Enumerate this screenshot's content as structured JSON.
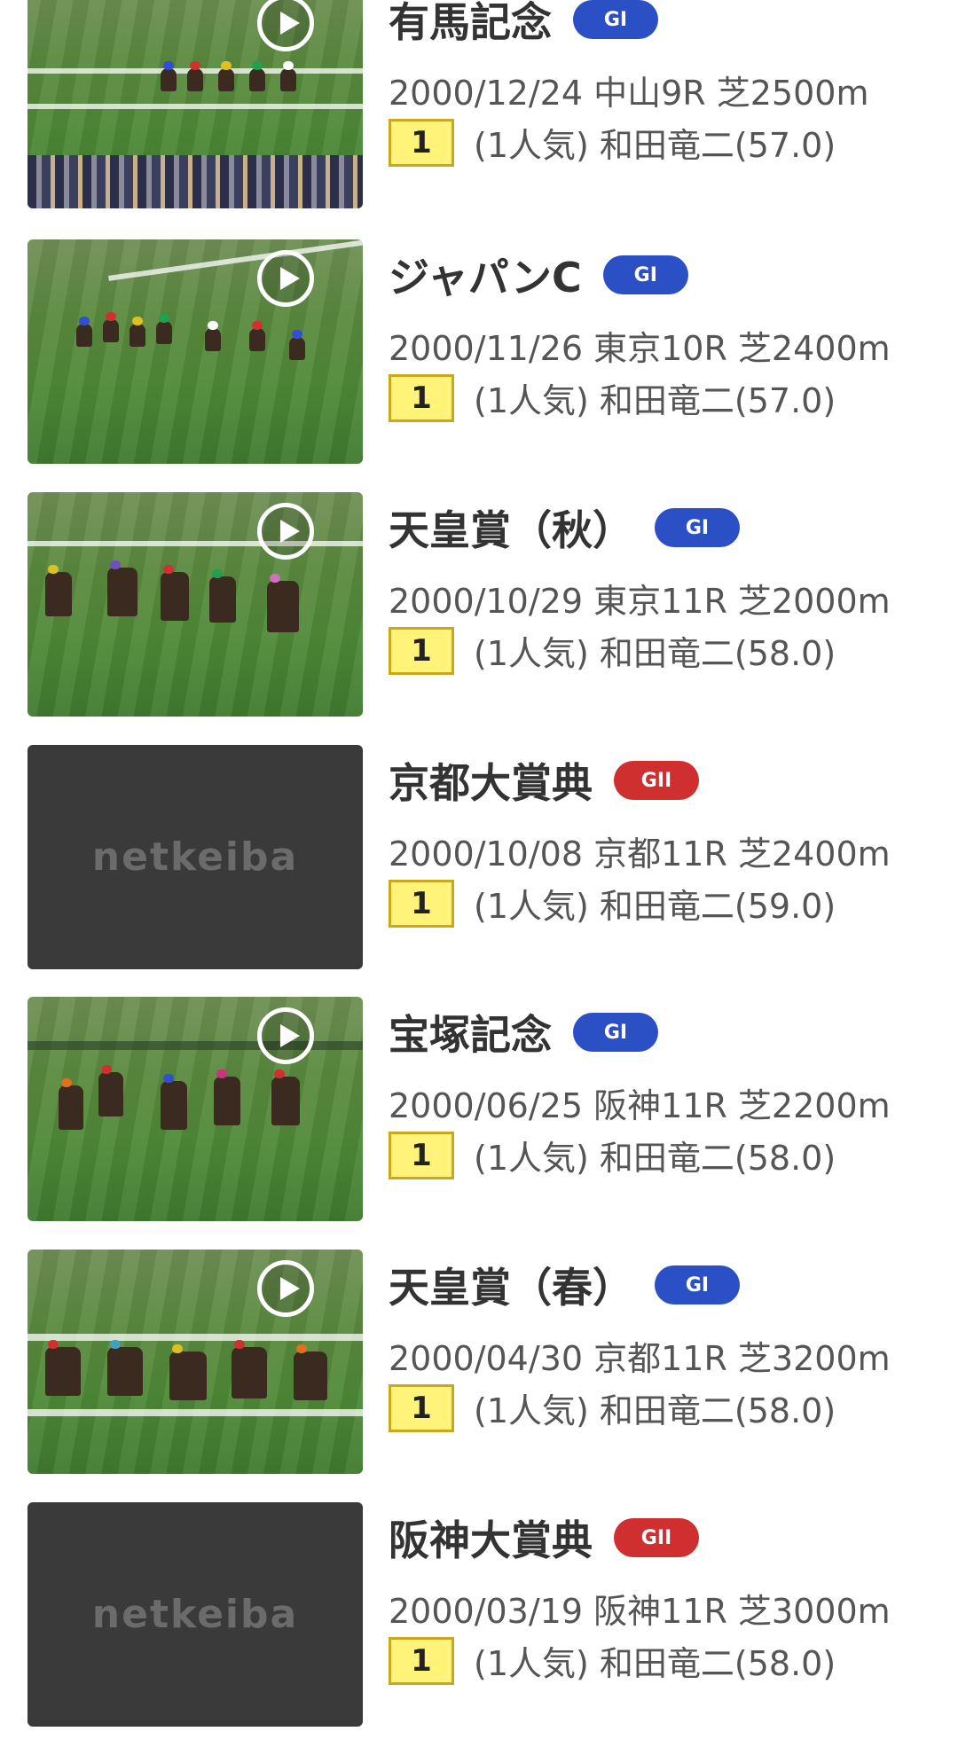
{
  "races": [
    {
      "title": "有馬記念",
      "grade": "GI",
      "grade_color": "#2b4fc4",
      "date_course": "2000/12/24 中山9R 芝2500m",
      "rank": "1",
      "detail": "(1人気) 和田竜二(57.0)",
      "has_video": true
    },
    {
      "title": "ジャパンC",
      "grade": "GI",
      "grade_color": "#2b4fc4",
      "date_course": "2000/11/26 東京10R 芝2400m",
      "rank": "1",
      "detail": "(1人気) 和田竜二(57.0)",
      "has_video": true
    },
    {
      "title": "天皇賞（秋）",
      "grade": "GI",
      "grade_color": "#2b4fc4",
      "date_course": "2000/10/29 東京11R 芝2000m",
      "rank": "1",
      "detail": "(1人気) 和田竜二(58.0)",
      "has_video": true
    },
    {
      "title": "京都大賞典",
      "grade": "GII",
      "grade_color": "#d02f2f",
      "date_course": "2000/10/08 京都11R 芝2400m",
      "rank": "1",
      "detail": "(1人気) 和田竜二(59.0)",
      "has_video": false,
      "placeholder": "netkeiba"
    },
    {
      "title": "宝塚記念",
      "grade": "GI",
      "grade_color": "#2b4fc4",
      "date_course": "2000/06/25 阪神11R 芝2200m",
      "rank": "1",
      "detail": "(1人気) 和田竜二(58.0)",
      "has_video": true
    },
    {
      "title": "天皇賞（春）",
      "grade": "GI",
      "grade_color": "#2b4fc4",
      "date_course": "2000/04/30 京都11R 芝3200m",
      "rank": "1",
      "detail": "(1人気) 和田竜二(58.0)",
      "has_video": true
    },
    {
      "title": "阪神大賞典",
      "grade": "GII",
      "grade_color": "#d02f2f",
      "date_course": "2000/03/19 阪神11R 芝3000m",
      "rank": "1",
      "detail": "(1人気) 和田竜二(58.0)",
      "has_video": false,
      "placeholder": "netkeiba"
    }
  ]
}
